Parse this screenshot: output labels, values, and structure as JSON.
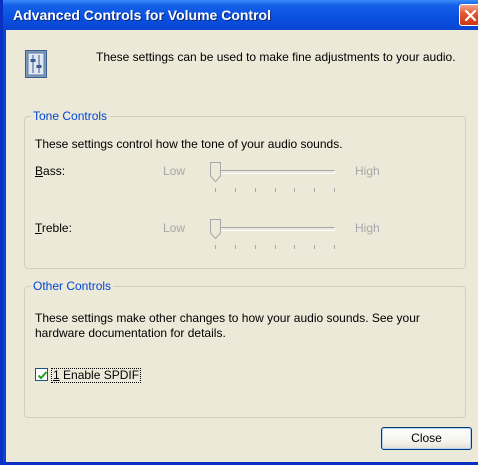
{
  "window": {
    "title": "Advanced Controls for Volume Control"
  },
  "intro": {
    "icon": "mixer-settings-icon",
    "text": "These settings can be used to make fine adjustments to your audio."
  },
  "tone_controls": {
    "legend": "Tone Controls",
    "description": "These settings control how the tone of your audio sounds.",
    "sliders": [
      {
        "key": "B",
        "rest": "ass:",
        "low": "Low",
        "high": "High",
        "value": 0
      },
      {
        "key": "T",
        "rest": "reble:",
        "low": "Low",
        "high": "High",
        "value": 0
      }
    ],
    "tick_count": 7
  },
  "other_controls": {
    "legend": "Other Controls",
    "description": "These settings make other changes to how your audio sounds.  See your hardware documentation for details.",
    "checkbox": {
      "key": "1",
      "rest": " Enable SPDIF",
      "checked": true
    }
  },
  "buttons": {
    "close_label": "Close"
  },
  "colors": {
    "title_bar": "#0a4fe0",
    "group_legend": "#0046d5",
    "disabled_text": "#a7a6aa",
    "dialog_bg": "#ece9d8",
    "close_red": "#e2552f"
  }
}
